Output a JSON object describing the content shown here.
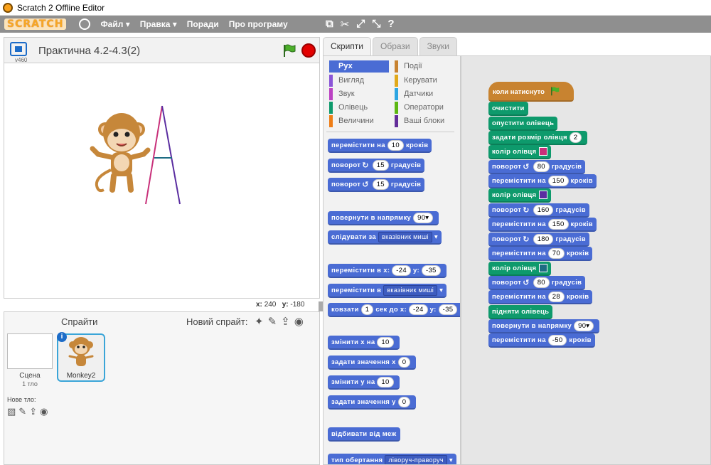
{
  "window": {
    "title": "Scratch 2 Offline Editor"
  },
  "menu": {
    "logo": "SCRATCH",
    "file": "Файл ▾",
    "edit": "Правка ▾",
    "tips": "Поради",
    "about": "Про програму"
  },
  "stage": {
    "version": "v460",
    "project_title": "Практична 4.2-4.3(2)",
    "x_label": "x:",
    "x_value": "240",
    "y_label": "y:",
    "y_value": "-180"
  },
  "sprites": {
    "header": "Спрайти",
    "new_sprite": "Новий спрайт:",
    "stage_label": "Сцена",
    "stage_sub": "1 тло",
    "new_backdrop": "Нове тло:",
    "sprite_name": "Monkey2"
  },
  "tabs": {
    "scripts": "Скрипти",
    "costumes": "Образи",
    "sounds": "Звуки"
  },
  "categories": {
    "motion": "Рух",
    "looks": "Вигляд",
    "sound": "Звук",
    "pen": "Олівець",
    "data": "Величини",
    "events": "Події",
    "control": "Керувати",
    "sensing": "Датчики",
    "operators": "Оператори",
    "more": "Ваші блоки"
  },
  "palette": {
    "move": "переміст",
    "move_full": "перемістити на",
    "steps": "кроків",
    "turn": "поворот",
    "degrees": "градусів",
    "point": "повернути в напрямку",
    "follow": "слідувати за",
    "mouse_pointer": "вказівник миші",
    "goto_xy": "перемістити в x:",
    "y": "y:",
    "goto": "перемістити в",
    "glide": "ковзати",
    "sec_to": "сек до x:",
    "change_x": "змінити х на",
    "set_x": "задати значення х",
    "change_y": "змінити у на",
    "set_y": "задати значення у",
    "bounce": "відбивати від меж",
    "rotation_style": "тип обертання",
    "left_right": "ліворуч-праворуч",
    "n10": "10",
    "n15": "15",
    "n90": "90▾",
    "n_24": "-24",
    "n_35": "-35",
    "n1": "1",
    "n0": "0"
  },
  "script": {
    "hat": "коли натиснуто",
    "clear": "очистити",
    "pen_down": "опустити олівець",
    "set_pen_size": "задати розмір олівця",
    "pen_color": "колір олівця",
    "turn": "поворот",
    "degrees": "градусів",
    "move": "перемістити на",
    "steps": "кроків",
    "pen_up": "підняти олівець",
    "point": "повернути в напрямку",
    "v2": "2",
    "v80": "80",
    "v150": "150",
    "v160": "160",
    "v180": "180",
    "v70": "70",
    "v28": "28",
    "v90": "90▾",
    "v_50": "-50"
  },
  "colors": {
    "pen1": "#c8307a",
    "pen2": "#5a2da0",
    "pen3": "#1d6c84"
  }
}
